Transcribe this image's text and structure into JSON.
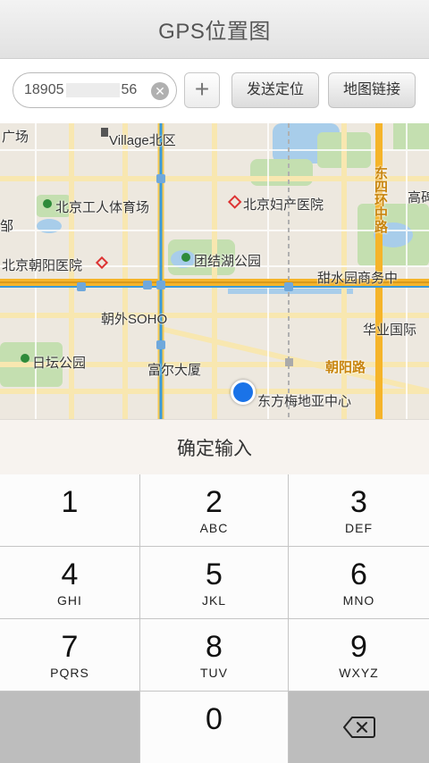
{
  "nav": {
    "title": "GPS位置图"
  },
  "toolbar": {
    "phone_prefix": "18905",
    "phone_suffix": "56",
    "clear_glyph": "✕",
    "plus_glyph": "+",
    "send_label": "发送定位",
    "link_label": "地图链接"
  },
  "map": {
    "labels": {
      "guangchang": "广场",
      "village": "Village北区",
      "gongti": "北京工人体育场",
      "fuchan": "北京妇产医院",
      "dongsihuan": "东四环中路",
      "gaobei": "高碑",
      "bei": "邹",
      "chaoyang_hosp": "北京朝阳医院",
      "tuanjiehu": "团结湖公园",
      "tianshui": "甜水园商务中",
      "chaowai": "朝外SOHO",
      "huaye": "华业国际",
      "ritan": "日坛公园",
      "fuer": "富尔大厦",
      "chaoyang_road": "朝阳路",
      "dongfangmei": "东方梅地亚中心"
    }
  },
  "confirm": {
    "label": "确定输入"
  },
  "keypad": {
    "keys": [
      {
        "digit": "1",
        "letters": ""
      },
      {
        "digit": "2",
        "letters": "ABC"
      },
      {
        "digit": "3",
        "letters": "DEF"
      },
      {
        "digit": "4",
        "letters": "GHI"
      },
      {
        "digit": "5",
        "letters": "JKL"
      },
      {
        "digit": "6",
        "letters": "MNO"
      },
      {
        "digit": "7",
        "letters": "PQRS"
      },
      {
        "digit": "8",
        "letters": "TUV"
      },
      {
        "digit": "9",
        "letters": "WXYZ"
      },
      {
        "digit": "0",
        "letters": ""
      }
    ]
  },
  "colors": {
    "accent": "#1a73e8",
    "major_road": "#f5b42a",
    "park": "#c4dfb0",
    "water": "#a8cdea"
  }
}
